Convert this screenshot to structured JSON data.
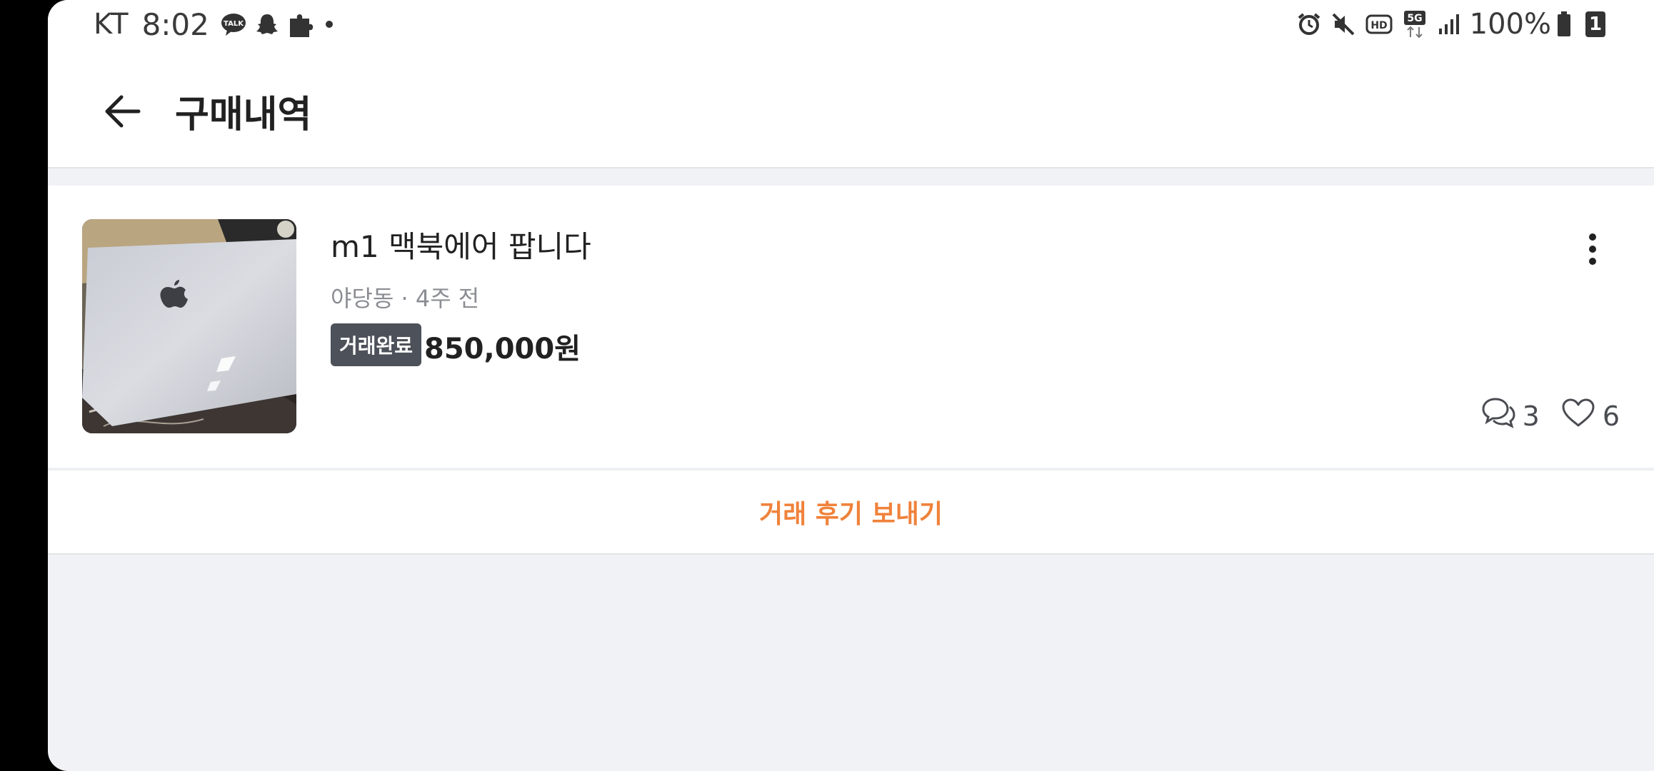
{
  "status_bar": {
    "carrier": "KT",
    "time": "8:02",
    "battery": "100%",
    "sim": "1",
    "left_icons": [
      "kakaotalk-icon",
      "snapchat-icon",
      "puzzle-icon",
      "dot-icon"
    ],
    "right_icons": [
      "alarm-icon",
      "mute-icon",
      "hd-icon",
      "5g-icon",
      "signal-icon",
      "battery-icon"
    ]
  },
  "header": {
    "title": "구매내역",
    "back_icon": "arrow-left-icon"
  },
  "item": {
    "title": "m1 맥북에어 팝니다",
    "meta": "야당동 · 4주 전",
    "status": "거래완료",
    "price": "850,000원",
    "chat_count": "3",
    "like_count": "6",
    "thumbnail": "macbook-photo"
  },
  "actions": {
    "review_label": "거래 후기 보내기"
  },
  "colors": {
    "accent": "#f0823b",
    "badge_bg": "#4d5159",
    "page_bg": "#f1f2f5"
  }
}
